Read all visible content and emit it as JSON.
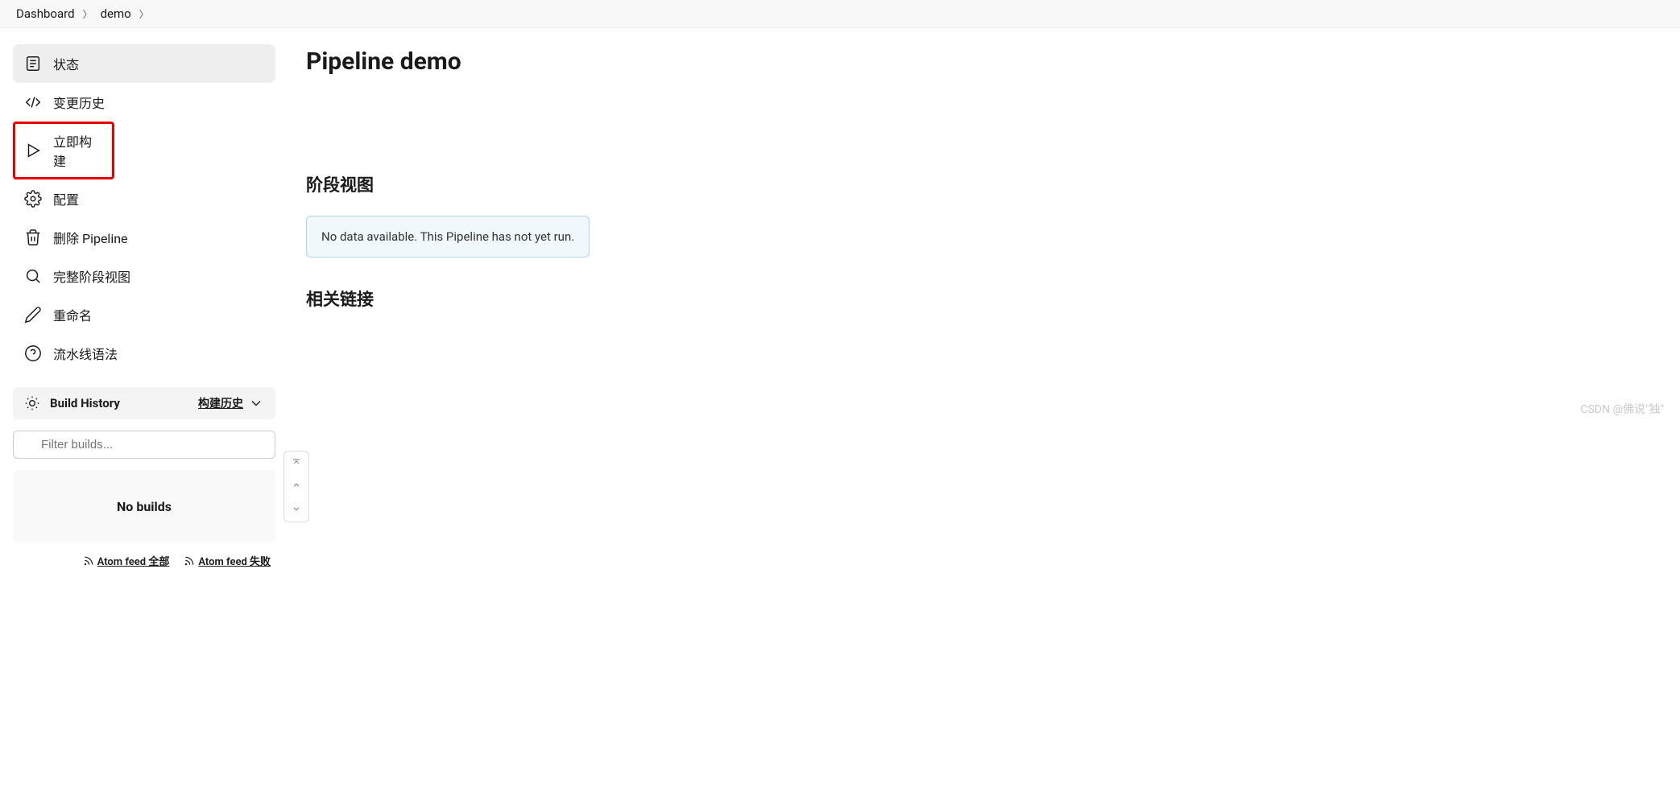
{
  "breadcrumb": {
    "items": [
      "Dashboard",
      "demo"
    ]
  },
  "sidebar": {
    "items": [
      {
        "label": "状态"
      },
      {
        "label": "变更历史"
      },
      {
        "label": "立即构建"
      },
      {
        "label": "配置"
      },
      {
        "label": "删除 Pipeline"
      },
      {
        "label": "完整阶段视图"
      },
      {
        "label": "重命名"
      },
      {
        "label": "流水线语法"
      }
    ]
  },
  "buildHistory": {
    "title": "Build History",
    "trendLabel": "构建历史",
    "filterPlaceholder": "Filter builds...",
    "noBuildsLabel": "No builds",
    "atomAll": "Atom feed 全部",
    "atomFail": "Atom feed 失败"
  },
  "main": {
    "title": "Pipeline demo",
    "stageViewHeading": "阶段视图",
    "noDataMessage": "No data available. This Pipeline has not yet run.",
    "relatedLinksHeading": "相关链接"
  },
  "watermark": "CSDN @佛说\"独\""
}
